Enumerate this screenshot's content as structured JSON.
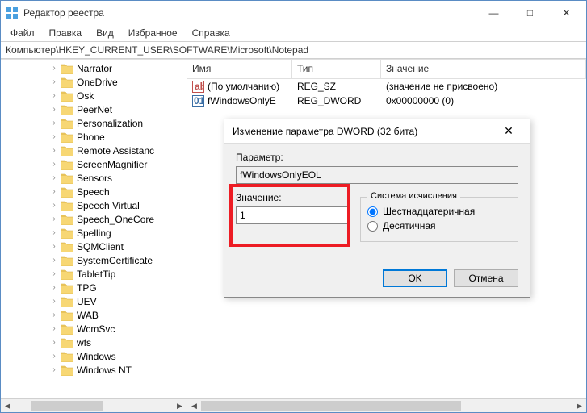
{
  "window": {
    "title": "Редактор реестра"
  },
  "winbtns": {
    "min": "—",
    "max": "□",
    "close": "✕"
  },
  "menu": {
    "file": "Файл",
    "edit": "Правка",
    "view": "Вид",
    "fav": "Избранное",
    "help": "Справка"
  },
  "address": "Компьютер\\HKEY_CURRENT_USER\\SOFTWARE\\Microsoft\\Notepad",
  "tree": [
    "Narrator",
    "OneDrive",
    "Osk",
    "PeerNet",
    "Personalization",
    "Phone",
    "Remote Assistanc",
    "ScreenMagnifier",
    "Sensors",
    "Speech",
    "Speech Virtual",
    "Speech_OneCore",
    "Spelling",
    "SQMClient",
    "SystemCertificate",
    "TabletTip",
    "TPG",
    "UEV",
    "WAB",
    "WcmSvc",
    "wfs",
    "Windows",
    "Windows NT"
  ],
  "cols": {
    "name": "Имя",
    "type": "Тип",
    "value": "Значение"
  },
  "rows": [
    {
      "icon": "sz",
      "name": "(По умолчанию)",
      "type": "REG_SZ",
      "value": "(значение не присвоено)"
    },
    {
      "icon": "dw",
      "name": "fWindowsOnlyE",
      "type": "REG_DWORD",
      "value": "0x00000000 (0)"
    }
  ],
  "dialog": {
    "title": "Изменение параметра DWORD (32 бита)",
    "param_label": "Параметр:",
    "param_value": "fWindowsOnlyEOL",
    "value_label": "Значение:",
    "value_value": "1",
    "radix_label": "Система исчисления",
    "hex": "Шестнадцатеричная",
    "dec": "Десятичная",
    "ok": "OK",
    "cancel": "Отмена"
  }
}
